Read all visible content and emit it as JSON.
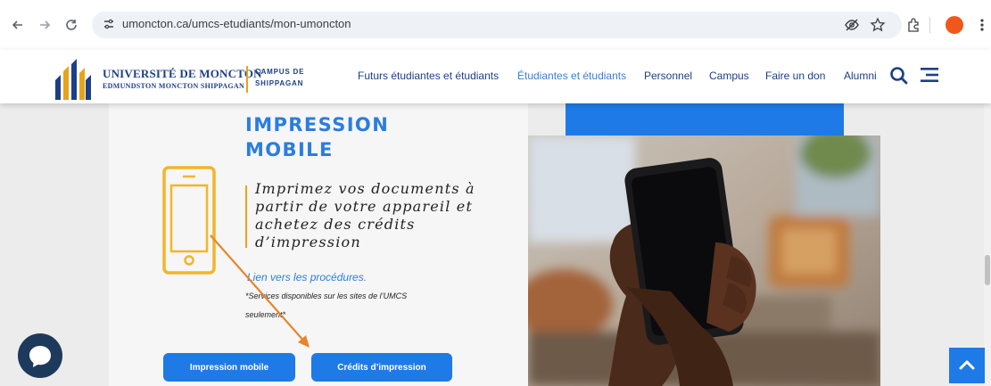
{
  "browser": {
    "url": "umoncton.ca/umcs-etudiants/mon-umoncton",
    "nav_icons": [
      "back-icon",
      "forward-icon",
      "reload-icon"
    ],
    "omnibox_icons": [
      "eye-off-icon",
      "star-icon"
    ],
    "toolbar_icons": [
      "extensions-icon",
      "profile-avatar",
      "more-icon"
    ],
    "profile_color": "#f0571b"
  },
  "header": {
    "university_name": "UNIVERSITÉ DE MONCTON",
    "university_sub": "EDMUNDSTON  MONCTON  SHIPPAGAN",
    "campus_line1": "CAMPUS DE",
    "campus_line2": "SHIPPAGAN",
    "nav": [
      {
        "label": "Futurs étudiantes et étudiants",
        "active": false
      },
      {
        "label": "Étudiantes et étudiants",
        "active": true
      },
      {
        "label": "Personnel",
        "active": false
      },
      {
        "label": "Campus",
        "active": false
      },
      {
        "label": "Faire un don",
        "active": false
      },
      {
        "label": "Alumni",
        "active": false
      }
    ],
    "brand_color": "#1d3f86",
    "accent_color": "#e8a317"
  },
  "content": {
    "title_line1": "IMPRESSION",
    "title_line2": "MOBILE",
    "quote": "Imprimez vos documents à partir de votre appareil et achetez des crédits d’impression",
    "procedures_link": "Lien vers les procédures.",
    "note_line1": "*Services disponibles sur les sites de l’UMCS",
    "note_line2": "seulement*",
    "button_mobile": "Impression mobile",
    "button_credits": "Crédits d’impression",
    "primary_color": "#1e7ae6",
    "annotation_arrow_color": "#e8832a"
  }
}
